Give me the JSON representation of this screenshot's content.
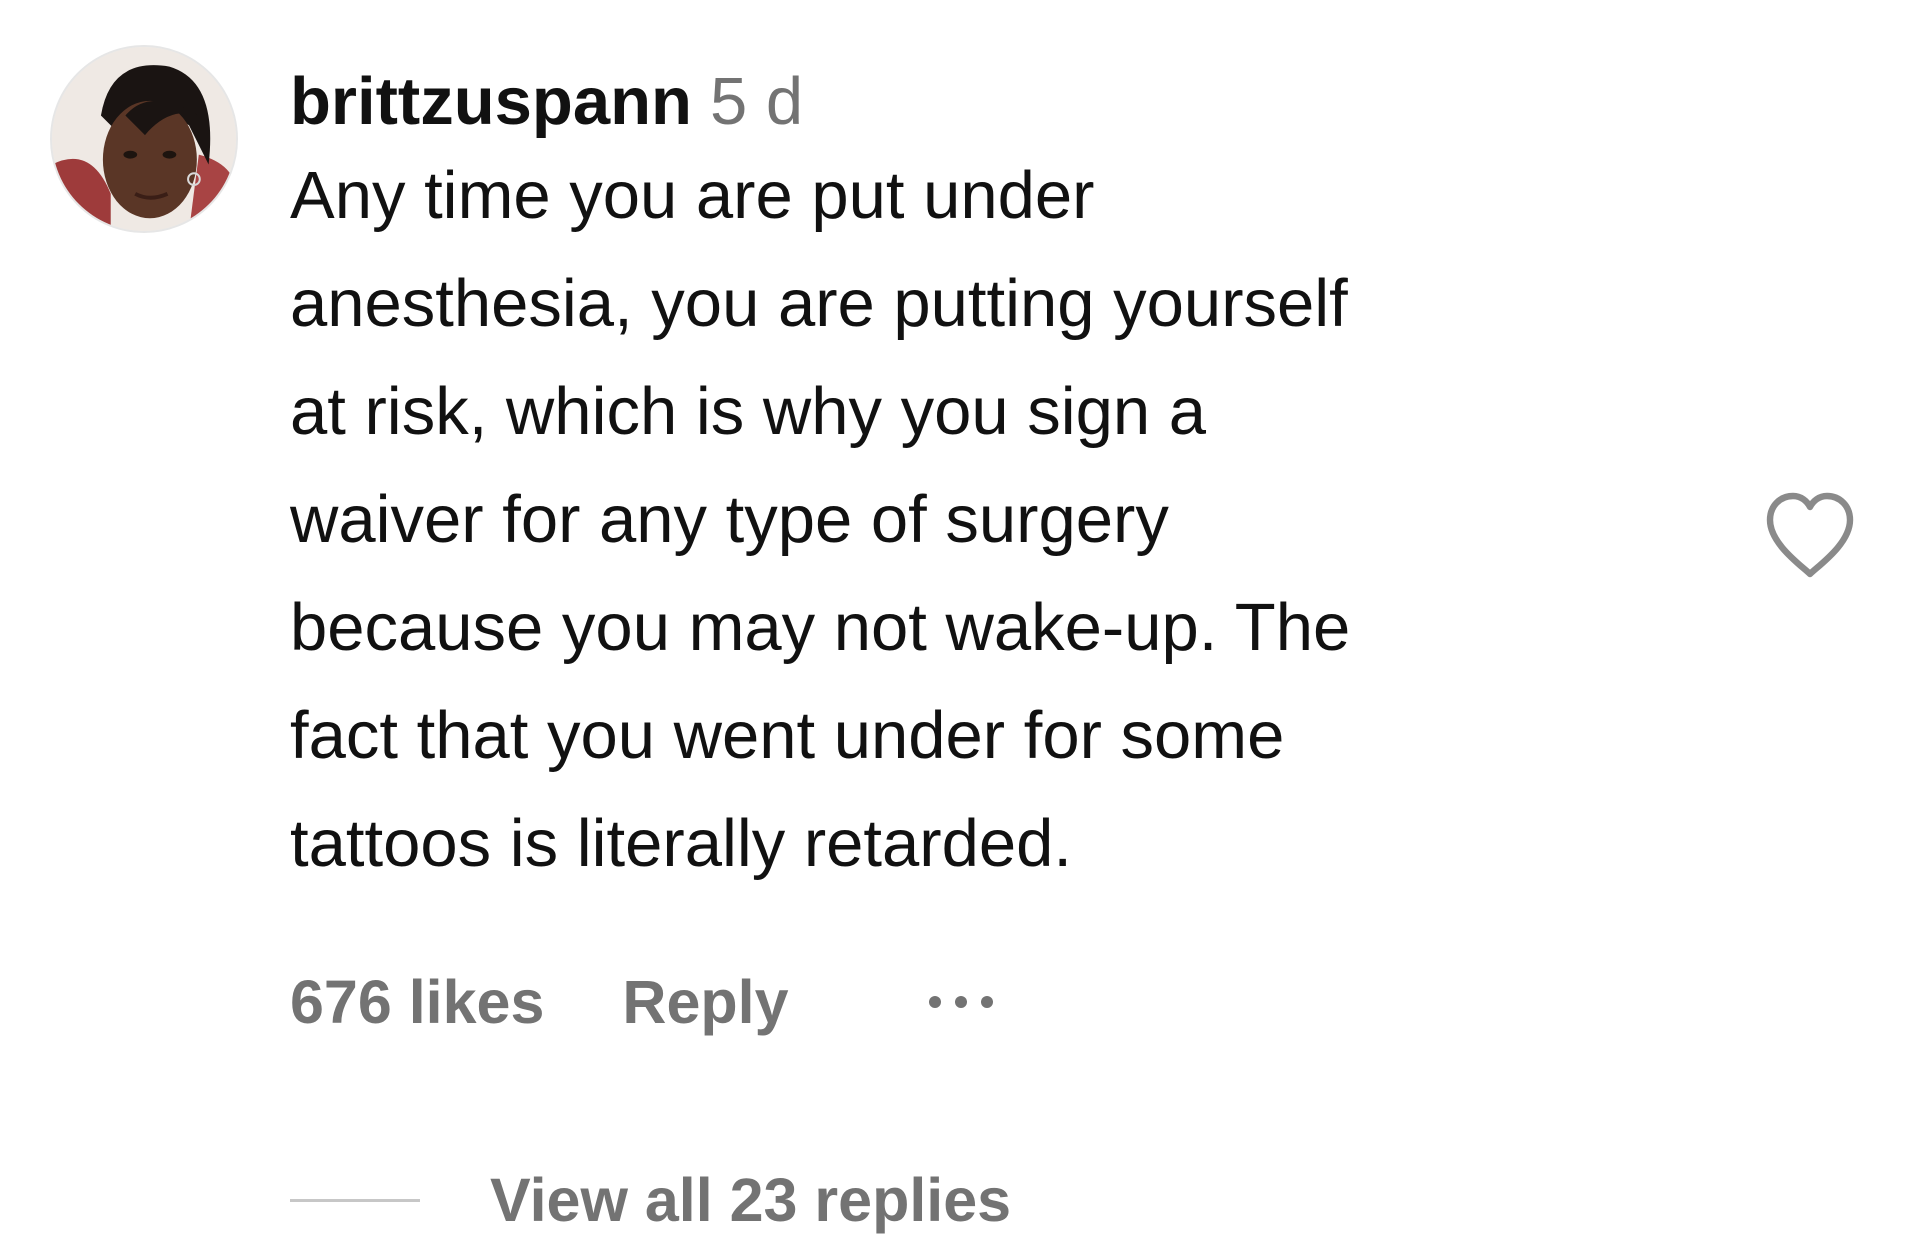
{
  "comment": {
    "username": "brittzuspann",
    "timestamp": "5 d",
    "text_lines": [
      "Any time you are put under",
      "anesthesia, you are putting yourself",
      "at risk, which is why you sign a",
      "waiver for any type of surgery",
      "because you may not wake-up. The",
      "fact that you went under for some",
      "tattoos is literally retarded."
    ],
    "likes": "676 likes",
    "reply_label": "Reply",
    "more_icon": "more-horizontal-icon",
    "like_icon": "heart-outline-icon",
    "view_replies_label": "View all 23 replies"
  },
  "colors": {
    "text_primary": "#111111",
    "text_secondary": "#737373",
    "divider": "#c7c7c7",
    "background": "#ffffff"
  }
}
